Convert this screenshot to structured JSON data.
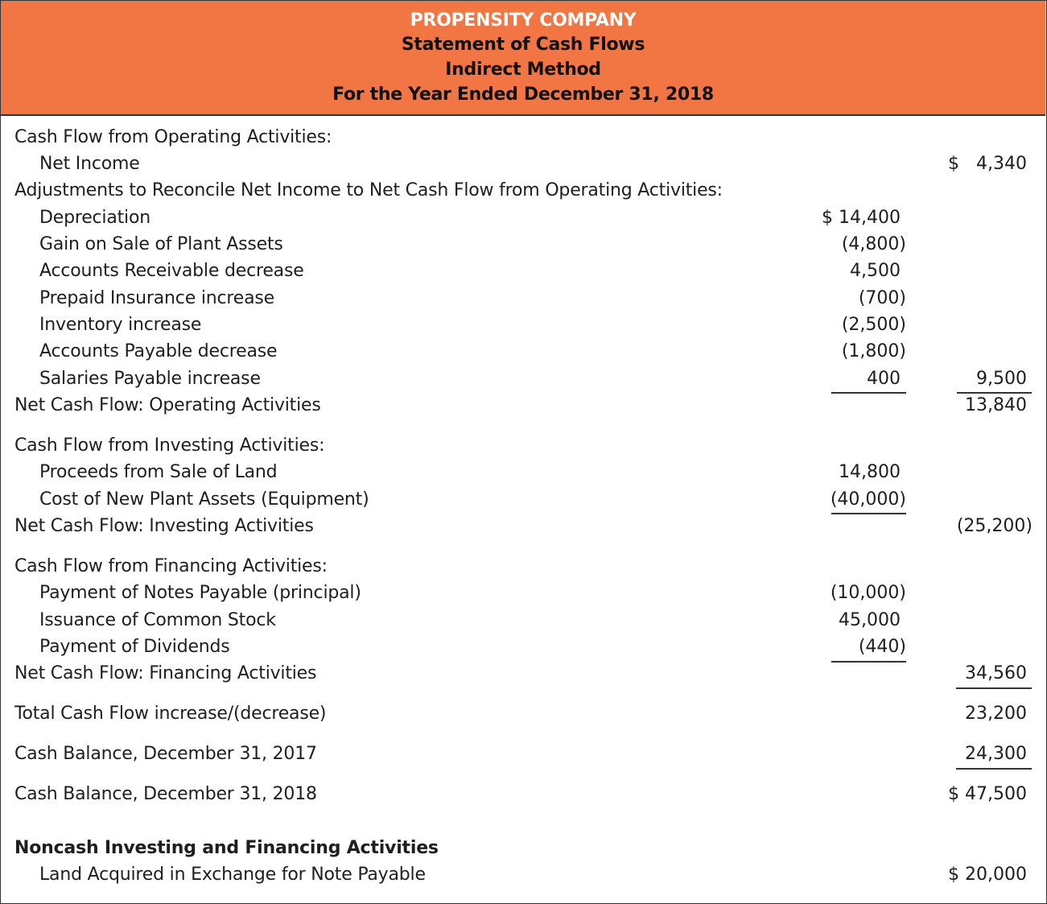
{
  "header": {
    "company": "PROPENSITY COMPANY",
    "statement": "Statement of Cash Flows",
    "method": "Indirect Method",
    "period": "For the Year Ended December 31, 2018"
  },
  "colors": {
    "header_bg": "#f27643",
    "company_text": "#ffffff",
    "text": "#1e1e1e"
  },
  "rows": [
    {
      "label": "Cash Flow from Operating Activities:",
      "indent": false,
      "col1": "",
      "col2": ""
    },
    {
      "label": "Net Income",
      "indent": true,
      "col1": "",
      "col2": "$   4,340"
    },
    {
      "label": "Adjustments to Reconcile Net Income to Net Cash Flow from Operating Activities:",
      "indent": false,
      "col1": "",
      "col2": ""
    },
    {
      "label": "Depreciation",
      "indent": true,
      "col1": "$ 14,400",
      "col2": ""
    },
    {
      "label": "Gain on Sale of Plant Assets",
      "indent": true,
      "col1": "(4,800)",
      "col2": ""
    },
    {
      "label": "Accounts Receivable decrease",
      "indent": true,
      "col1": "4,500",
      "col2": ""
    },
    {
      "label": "Prepaid Insurance increase",
      "indent": true,
      "col1": "(700)",
      "col2": ""
    },
    {
      "label": "Inventory increase",
      "indent": true,
      "col1": "(2,500)",
      "col2": ""
    },
    {
      "label": "Accounts Payable decrease",
      "indent": true,
      "col1": "(1,800)",
      "col2": ""
    },
    {
      "label": "Salaries Payable increase",
      "indent": true,
      "col1": "400",
      "col2": "9,500"
    },
    {
      "label": "Net Cash Flow: Operating Activities",
      "indent": false,
      "col1": "",
      "col2": "13,840"
    },
    {
      "label": "Cash Flow from Investing Activities:",
      "indent": false,
      "col1": "",
      "col2": ""
    },
    {
      "label": "Proceeds from Sale of Land",
      "indent": true,
      "col1": "14,800",
      "col2": ""
    },
    {
      "label": "Cost of New Plant Assets (Equipment)",
      "indent": true,
      "col1": "(40,000)",
      "col2": ""
    },
    {
      "label": "Net Cash Flow: Investing Activities",
      "indent": false,
      "col1": "",
      "col2": "(25,200)"
    },
    {
      "label": "Cash Flow from Financing Activities:",
      "indent": false,
      "col1": "",
      "col2": ""
    },
    {
      "label": "Payment of Notes Payable (principal)",
      "indent": true,
      "col1": "(10,000)",
      "col2": ""
    },
    {
      "label": "Issuance of Common Stock",
      "indent": true,
      "col1": "45,000",
      "col2": ""
    },
    {
      "label": "Payment of Dividends",
      "indent": true,
      "col1": "(440)",
      "col2": ""
    },
    {
      "label": "Net Cash Flow: Financing Activities",
      "indent": false,
      "col1": "",
      "col2": "34,560"
    },
    {
      "label": "Total Cash Flow increase/(decrease)",
      "indent": false,
      "col1": "",
      "col2": "23,200"
    },
    {
      "label": "Cash Balance, December 31, 2017",
      "indent": false,
      "col1": "",
      "col2": "24,300"
    },
    {
      "label": "Cash Balance, December 31, 2018",
      "indent": false,
      "col1": "",
      "col2": "$ 47,500"
    },
    {
      "label": "Noncash Investing and Financing Activities",
      "indent": false,
      "bold": true,
      "col1": "",
      "col2": ""
    },
    {
      "label": "Land Acquired in Exchange for Note Payable",
      "indent": true,
      "col1": "",
      "col2": "$ 20,000"
    }
  ]
}
